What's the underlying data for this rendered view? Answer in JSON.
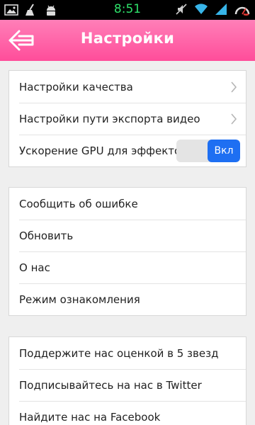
{
  "status_bar": {
    "time": "8:51",
    "left_icons": [
      "gallery-icon",
      "broom-icon",
      "android-icon"
    ],
    "right_icons": [
      "mute-icon",
      "wifi-icon",
      "signal-icon",
      "speedometer-icon"
    ],
    "time_color": "#2ee06a"
  },
  "header": {
    "title": "Настройки",
    "back_icon": "back-arrow-icon",
    "gradient_top": "#ff7fb8",
    "gradient_bottom": "#ff4d9a"
  },
  "group1": {
    "quality": "Настройки качества",
    "export_path": "Настройки пути экспорта видео",
    "gpu": "Ускорение GPU для эффектов",
    "gpu_toggle_label": "Вкл",
    "gpu_toggle_state": "on"
  },
  "group2": {
    "report_bug": "Сообщить об ошибке",
    "update": "Обновить",
    "about": "О нас",
    "tour": "Режим ознакомления"
  },
  "group3": {
    "rate": "Поддержите нас оценкой в 5 звезд",
    "twitter": "Подписывайтесь на нас в Twitter",
    "facebook": "Найдите нас на Facebook"
  },
  "accent_color": "#1e6ff2"
}
